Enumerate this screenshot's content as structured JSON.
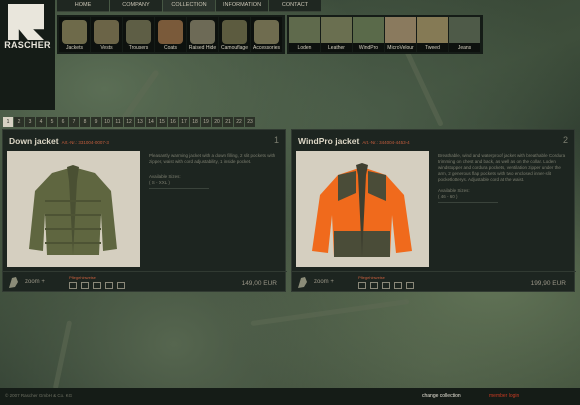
{
  "brand": {
    "name": "RASCHER"
  },
  "nav": {
    "tabs": [
      "HOME",
      "COMPANY",
      "COLLECTION",
      "INFORMATION",
      "CONTACT"
    ]
  },
  "categories": [
    "Jackets",
    "Vests",
    "Trousers",
    "Coats",
    "Raised Hide",
    "Camouflage",
    "Accessories"
  ],
  "fabrics": [
    "Loden",
    "Leather",
    "WindPro",
    "MicroVelour",
    "Tweed",
    "Jeans"
  ],
  "pager": [
    "1",
    "2",
    "3",
    "4",
    "5",
    "6",
    "7",
    "8",
    "9",
    "10",
    "11",
    "12",
    "13",
    "14",
    "15",
    "16",
    "17",
    "18",
    "19",
    "20",
    "21",
    "22",
    "23"
  ],
  "products": [
    {
      "title": "Down jacket",
      "artno": "Art.-Nr.: 331004-0007-3",
      "num": "1",
      "desc": "Pleasantly warming jacket with a down filling, 2 slit pockets with zipper, waist with cord adjustability, 1 inside pocket.",
      "sizes_label": "Available Sizes:",
      "sizes": "( S - XXL )",
      "zoom": "zoom +",
      "care_label": "Pflegehinweise",
      "price": "149,00 EUR"
    },
    {
      "title": "WindPro jacket",
      "artno": "Art.-Nr.: 344004-4453-4",
      "num": "2",
      "desc": "Breathable, wind and waterproof jacket with breathable Cordura trimming on chest and back, as well as on the collar. Loden windstopper and cordura pockets, ventilation zipper under the arm, 2 generous flap pockets with two enclosed inner-slit pocketlotterys. Adjustable cord at the waist.",
      "sizes_label": "Available Sizes:",
      "sizes": "( 46 - 60 )",
      "zoom": "zoom +",
      "care_label": "Pflegehinweise",
      "price": "199,90 EUR"
    }
  ],
  "footer": {
    "copyright": "© 2007 Rascher GmbH & Co. KG",
    "change": "change collection",
    "member": "member login"
  }
}
